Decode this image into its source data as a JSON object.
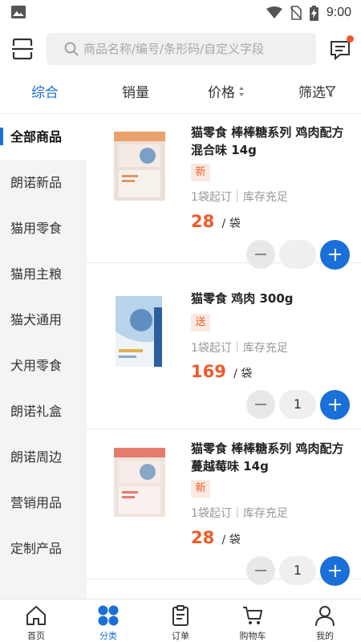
{
  "status_bar": {
    "time": "9:00"
  },
  "search": {
    "placeholder": "商品名称/编号/条形码/自定义字段"
  },
  "sort_tabs": [
    "综合",
    "销量",
    "价格",
    "筛选"
  ],
  "sidebar": {
    "items": [
      "全部商品",
      "朗诺新品",
      "猫用零食",
      "猫用主粮",
      "猫犬通用",
      "犬用零食",
      "朗诺礼盒",
      "朗诺周边",
      "营销用品",
      "定制产品"
    ],
    "active": "全部商品"
  },
  "products": [
    {
      "name": "猫零食 棒棒糖系列 鸡肉配方 混合味 14g",
      "badge": "新",
      "stock": "1袋起订｜库存充足",
      "price": "28",
      "unit": "/ 袋",
      "qty": ""
    },
    {
      "name": "猫零食 鸡肉 300g",
      "badge": "送",
      "stock": "1袋起订｜库存充足",
      "price": "169",
      "unit": "/ 袋",
      "qty": "1"
    },
    {
      "name": "猫零食 棒棒糖系列 鸡肉配方 蔓越莓味 14g",
      "badge": "新",
      "stock": "1袋起订｜库存充足",
      "price": "28",
      "unit": "/ 袋",
      "qty": "1"
    }
  ],
  "bottom_nav": [
    {
      "label": "首页",
      "icon": "home-icon"
    },
    {
      "label": "分类",
      "icon": "category-icon",
      "active": true
    },
    {
      "label": "订单",
      "icon": "order-icon"
    },
    {
      "label": "购物车",
      "icon": "cart-icon"
    },
    {
      "label": "我的",
      "icon": "profile-icon"
    }
  ],
  "colors": {
    "accent": "#1a6fd8",
    "price": "#f05a28",
    "badge_bg": "#fde9e0",
    "sidebar_bg": "#f4f4f4"
  }
}
